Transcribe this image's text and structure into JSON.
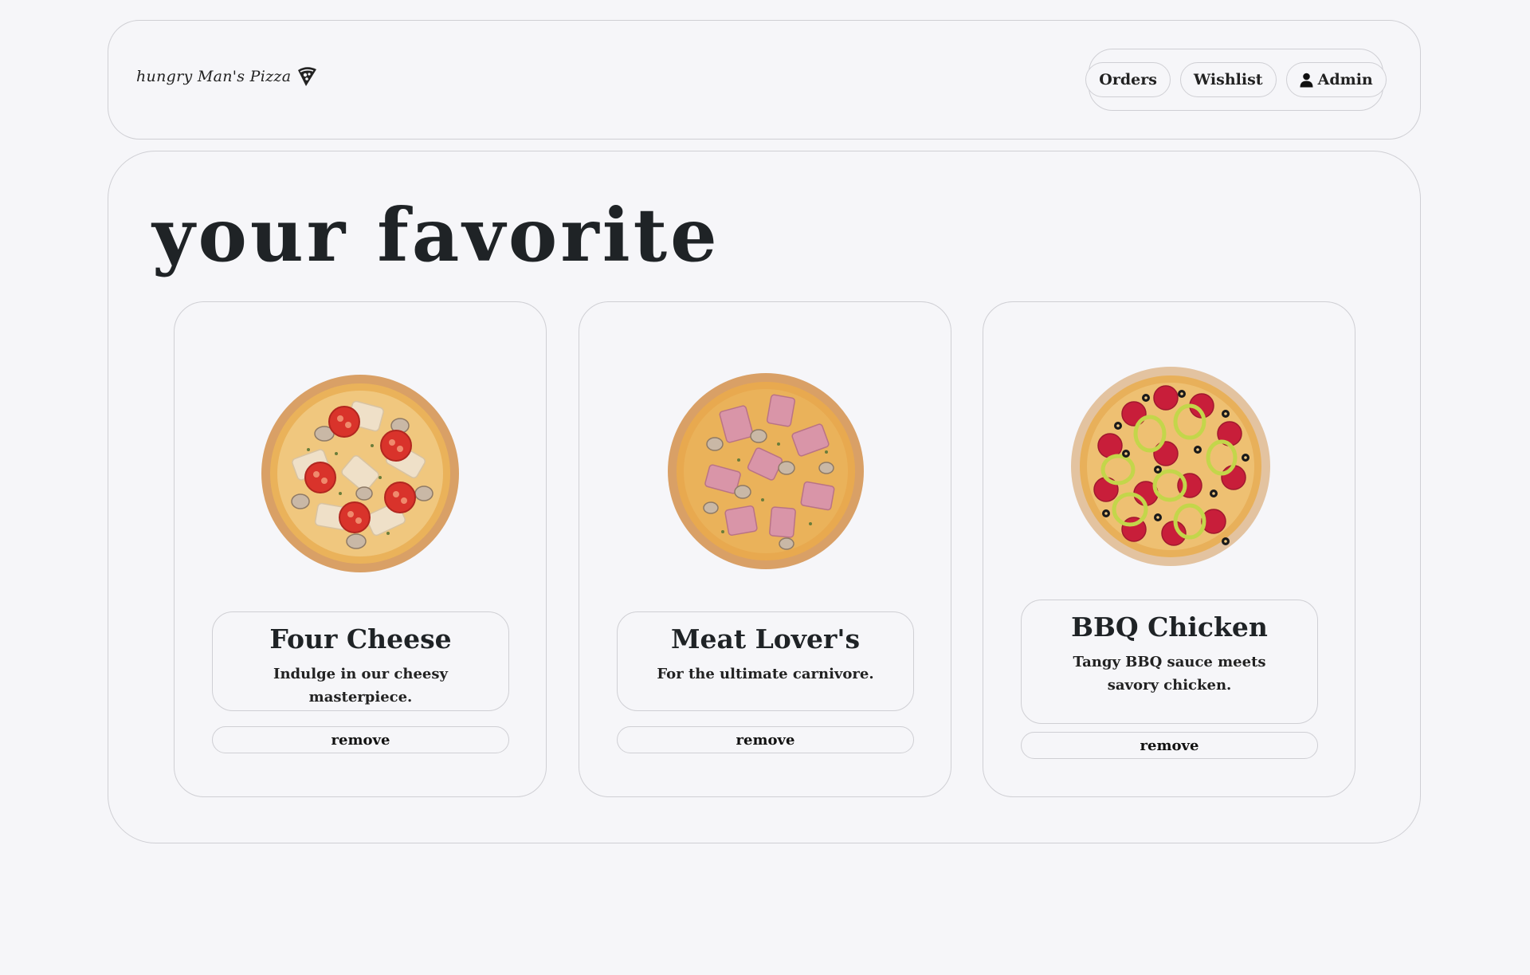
{
  "header": {
    "logo_text": "hungry Man's Pizza",
    "logo_icon": "pizza-slice-icon",
    "nav": [
      {
        "label": "Orders"
      },
      {
        "label": "Wishlist"
      },
      {
        "label": "Admin",
        "icon": "user-icon"
      }
    ]
  },
  "main": {
    "title": "your favorite",
    "cards": [
      {
        "name": "Four Cheese",
        "description": "Indulge in our cheesy masterpiece.",
        "action": "remove"
      },
      {
        "name": "Meat Lover's",
        "description": "For the ultimate carnivore.",
        "action": "remove"
      },
      {
        "name": "BBQ Chicken",
        "description": "Tangy BBQ sauce meets savory chicken.",
        "action": "remove"
      }
    ]
  },
  "colors": {
    "background": "#f6f6f9",
    "border": "#cfcfd4",
    "text": "#222222",
    "crust": "#d9a066",
    "cheese": "#eab25a",
    "tomato": "#d9332b",
    "ham": "#d995a8",
    "pepperoni": "#c81e3a",
    "pepper_ring": "#c3d64a"
  }
}
